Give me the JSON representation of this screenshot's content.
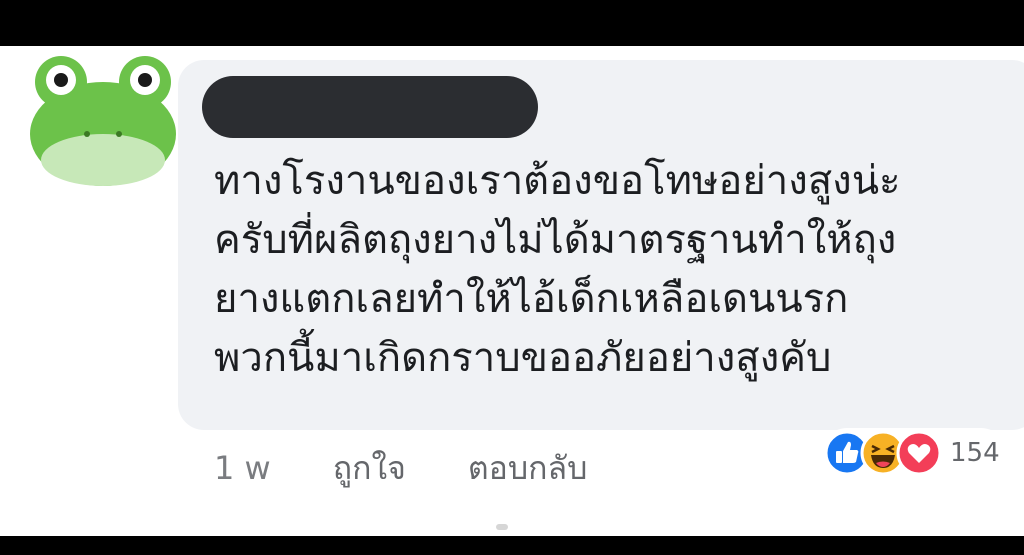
{
  "comment": {
    "author_name": "",
    "lines": [
      "ทางโรงานของเราต้องขอโทษอย่างสูงน่ะ",
      "ครับที่ผลิตถุงยางไม่ได้มาตรฐานทำให้ถุง",
      "ยางแตกเลยทำให้ไอ้เด็กเหลือเดนนรก",
      "พวกนี้มาเกิดกราบขออภัยอย่างสูงคับ"
    ],
    "timestamp": "1 w",
    "like_label": "ถูกใจ",
    "reply_label": "ตอบกลับ",
    "reaction_count": "154",
    "reactions": [
      "like-icon",
      "haha-icon",
      "love-icon"
    ]
  },
  "colors": {
    "bubble": "#f0f2f5",
    "like": "#1877f2",
    "haha": "#f7b125",
    "love": "#f33e58",
    "avatar_green": "#6cc24a"
  }
}
